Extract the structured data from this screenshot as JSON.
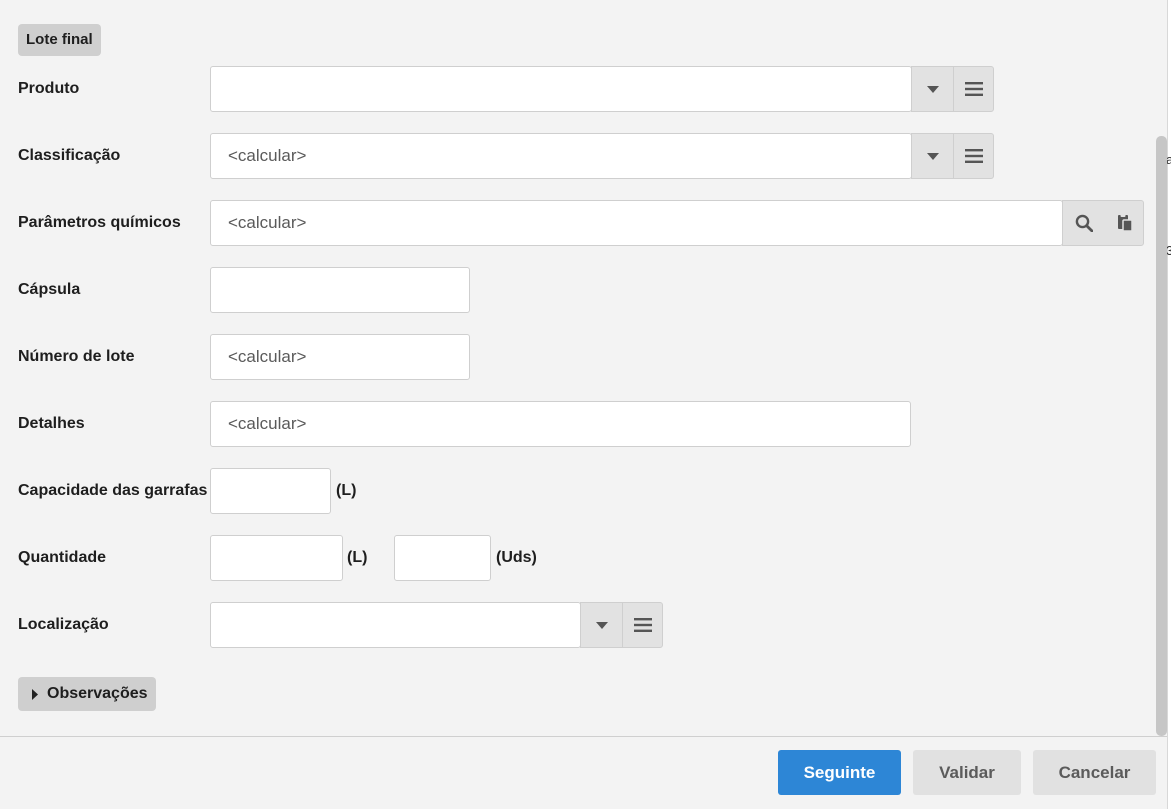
{
  "section": {
    "title": "Lote final"
  },
  "fields": {
    "produto": {
      "label": "Produto",
      "value": ""
    },
    "classificacao": {
      "label": "Classificação",
      "value": "<calcular>"
    },
    "parametros": {
      "label": "Parâmetros químicos",
      "value": "<calcular>"
    },
    "capsula": {
      "label": "Cápsula",
      "value": ""
    },
    "numero_lote": {
      "label": "Número de lote",
      "value": "<calcular>"
    },
    "detalhes": {
      "label": "Detalhes",
      "value": "<calcular>"
    },
    "capacidade": {
      "label": "Capacidade das garrafas",
      "value": "",
      "unit": "(L)"
    },
    "quantidade": {
      "label": "Quantidade",
      "value_l": "",
      "unit_l": "(L)",
      "value_uds": "",
      "unit_uds": "(Uds)"
    },
    "localizacao": {
      "label": "Localização",
      "value": ""
    }
  },
  "observacoes": {
    "label": "Observações"
  },
  "buttons": {
    "next": "Seguinte",
    "validate": "Validar",
    "cancel": "Cancelar"
  },
  "edge_glyphs": [
    "a",
    "3"
  ],
  "icons": [
    "chevron-down-icon",
    "list-icon",
    "search-icon",
    "clipboard-icon",
    "triangle-right-icon"
  ],
  "colors": {
    "primary": "#2d86d6",
    "background": "#f3f3f3",
    "field_border": "#cfcfcf",
    "button_block": "#e2e2e2"
  }
}
